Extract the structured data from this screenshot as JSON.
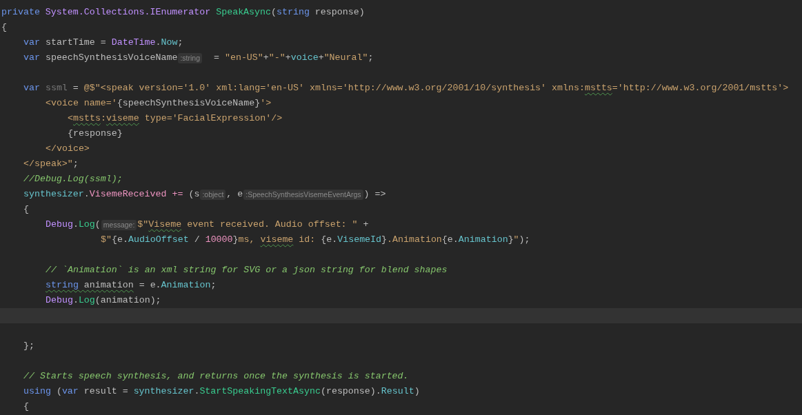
{
  "editor": {
    "lines": [
      {
        "kind": "code",
        "tokens": [
          {
            "kind": "kw",
            "t": "private "
          },
          {
            "kind": "type",
            "t": "System.Collections.IEnumerator "
          },
          {
            "kind": "method",
            "t": "SpeakAsync"
          },
          {
            "kind": "plain",
            "t": "("
          },
          {
            "kind": "kw",
            "t": "string"
          },
          {
            "kind": "plain",
            "t": " response)"
          }
        ]
      },
      {
        "kind": "code",
        "tokens": [
          {
            "kind": "plain",
            "t": "{"
          }
        ],
        "children": [
          {
            "kind": "code",
            "tokens": [
              {
                "kind": "kw",
                "t": "var "
              },
              {
                "kind": "plain",
                "t": "startTime = "
              },
              {
                "kind": "type",
                "t": "DateTime"
              },
              {
                "kind": "plain",
                "t": "."
              },
              {
                "kind": "prop",
                "t": "Now"
              },
              {
                "kind": "plain",
                "t": ";"
              }
            ]
          },
          {
            "kind": "code",
            "tokens": [
              {
                "kind": "kw",
                "t": "var "
              },
              {
                "kind": "plain",
                "t": "speechSynthesisVoiceName"
              },
              {
                "kind": "hint",
                "t": ":string"
              },
              {
                "kind": "plain",
                "t": "  = "
              },
              {
                "kind": "str",
                "t": "\"en-US\""
              },
              {
                "kind": "plain",
                "t": "+"
              },
              {
                "kind": "str",
                "t": "\"-\""
              },
              {
                "kind": "plain",
                "t": "+"
              },
              {
                "kind": "prop",
                "t": "voice"
              },
              {
                "kind": "plain",
                "t": "+"
              },
              {
                "kind": "str",
                "t": "\"Neural\""
              },
              {
                "kind": "plain",
                "t": ";"
              }
            ]
          },
          {
            "kind": "blank"
          },
          {
            "kind": "code",
            "tokens": [
              {
                "kind": "kw",
                "t": "var "
              },
              {
                "kind": "dim",
                "t": "ssml"
              },
              {
                "kind": "plain",
                "t": " = "
              },
              {
                "kind": "str",
                "t": "@$\"<speak version='1.0' xml:lang='en-US' xmlns='http://www.w3.org/2001/10/synthesis' xmlns:"
              },
              {
                "kind": "str",
                "t": "mstts",
                "warn": true
              },
              {
                "kind": "str",
                "t": "='http://www.w3.org/2001/mstts'>"
              }
            ],
            "children": [
              {
                "kind": "code",
                "tokens": [
                  {
                    "kind": "str",
                    "t": "<voice name='"
                  },
                  {
                    "kind": "plain",
                    "t": "{speechSynthesisVoiceName}"
                  },
                  {
                    "kind": "str",
                    "t": "'>"
                  }
                ],
                "children": [
                  {
                    "kind": "code",
                    "tokens": [
                      {
                        "kind": "str",
                        "t": "<"
                      },
                      {
                        "kind": "str",
                        "t": "mstts",
                        "warn": true
                      },
                      {
                        "kind": "str",
                        "t": ":"
                      },
                      {
                        "kind": "str",
                        "t": "viseme",
                        "warn": true
                      },
                      {
                        "kind": "str",
                        "t": " type='FacialExpression'/>"
                      }
                    ]
                  },
                  {
                    "kind": "code",
                    "tokens": [
                      {
                        "kind": "plain",
                        "t": "{response}"
                      }
                    ]
                  }
                ]
              },
              {
                "kind": "code",
                "tokens": [
                  {
                    "kind": "str",
                    "t": "</voice>"
                  }
                ]
              }
            ]
          },
          {
            "kind": "code",
            "tokens": [
              {
                "kind": "str",
                "t": "</speak>\""
              },
              {
                "kind": "plain",
                "t": ";"
              }
            ]
          },
          {
            "kind": "code",
            "tokens": [
              {
                "kind": "comment",
                "t": "//Debug.Log(ssml);"
              }
            ]
          },
          {
            "kind": "code",
            "tokens": [
              {
                "kind": "prop",
                "t": "synthesizer"
              },
              {
                "kind": "plain",
                "t": "."
              },
              {
                "kind": "event",
                "t": "VisemeReceived"
              },
              {
                "kind": "event",
                "t": " += "
              },
              {
                "kind": "plain",
                "t": "("
              },
              {
                "kind": "plain",
                "t": "s"
              },
              {
                "kind": "hint",
                "t": ":object"
              },
              {
                "kind": "plain",
                "t": ", e"
              },
              {
                "kind": "hint",
                "t": ":SpeechSynthesisVisemeEventArgs"
              },
              {
                "kind": "plain",
                "t": ") =>"
              }
            ]
          },
          {
            "kind": "code",
            "tokens": [
              {
                "kind": "plain",
                "t": "{"
              }
            ],
            "children": [
              {
                "kind": "code",
                "tokens": [
                  {
                    "kind": "type",
                    "t": "Debug"
                  },
                  {
                    "kind": "plain",
                    "t": "."
                  },
                  {
                    "kind": "method",
                    "t": "Log"
                  },
                  {
                    "kind": "plain",
                    "t": "("
                  },
                  {
                    "kind": "hint",
                    "t": "message:"
                  },
                  {
                    "kind": "str",
                    "t": "$\""
                  },
                  {
                    "kind": "str",
                    "t": "Viseme",
                    "warn": true
                  },
                  {
                    "kind": "str",
                    "t": " event received. Audio offset: \""
                  },
                  {
                    "kind": "plain",
                    "t": " +"
                  }
                ],
                "children": [
                  {
                    "kind": "continuation",
                    "tokens": [
                      {
                        "kind": "str",
                        "t": "$\""
                      },
                      {
                        "kind": "plain",
                        "t": "{e."
                      },
                      {
                        "kind": "prop",
                        "t": "AudioOffset"
                      },
                      {
                        "kind": "plain",
                        "t": " / "
                      },
                      {
                        "kind": "num",
                        "t": "10000"
                      },
                      {
                        "kind": "plain",
                        "t": "}"
                      },
                      {
                        "kind": "str",
                        "t": "ms, "
                      },
                      {
                        "kind": "str",
                        "t": "viseme",
                        "warn": true
                      },
                      {
                        "kind": "str",
                        "t": " id: "
                      },
                      {
                        "kind": "plain",
                        "t": "{e."
                      },
                      {
                        "kind": "prop",
                        "t": "VisemeId"
                      },
                      {
                        "kind": "plain",
                        "t": "}"
                      },
                      {
                        "kind": "str",
                        "t": ".Animation"
                      },
                      {
                        "kind": "plain",
                        "t": "{e."
                      },
                      {
                        "kind": "prop",
                        "t": "Animation"
                      },
                      {
                        "kind": "plain",
                        "t": "}"
                      },
                      {
                        "kind": "str",
                        "t": "\""
                      },
                      {
                        "kind": "plain",
                        "t": ");"
                      }
                    ]
                  }
                ]
              },
              {
                "kind": "blank"
              },
              {
                "kind": "code",
                "tokens": [
                  {
                    "kind": "comment",
                    "t": "// `Animation` is an xml string for SVG or a json string for blend shapes"
                  }
                ]
              },
              {
                "kind": "code",
                "tokens": [
                  {
                    "kind": "kw",
                    "t": "string ",
                    "warn": true
                  },
                  {
                    "kind": "plain",
                    "t": "animation",
                    "warn": true
                  },
                  {
                    "kind": "plain",
                    "t": " = e."
                  },
                  {
                    "kind": "prop",
                    "t": "Animation"
                  },
                  {
                    "kind": "plain",
                    "t": ";"
                  }
                ]
              },
              {
                "kind": "code",
                "tokens": [
                  {
                    "kind": "type",
                    "t": "Debug"
                  },
                  {
                    "kind": "plain",
                    "t": "."
                  },
                  {
                    "kind": "method",
                    "t": "Log"
                  },
                  {
                    "kind": "plain",
                    "t": "(animation);"
                  }
                ]
              },
              {
                "kind": "blank",
                "current": true
              },
              {
                "kind": "blank"
              }
            ]
          },
          {
            "kind": "code",
            "tokens": [
              {
                "kind": "plain",
                "t": "};"
              }
            ]
          },
          {
            "kind": "blank"
          },
          {
            "kind": "code",
            "tokens": [
              {
                "kind": "comment",
                "t": "// Starts speech synthesis, and returns once the synthesis is started."
              }
            ]
          },
          {
            "kind": "code",
            "tokens": [
              {
                "kind": "kw",
                "t": "using "
              },
              {
                "kind": "plain",
                "t": "("
              },
              {
                "kind": "kw",
                "t": "var "
              },
              {
                "kind": "plain",
                "t": "result = "
              },
              {
                "kind": "prop",
                "t": "synthesizer"
              },
              {
                "kind": "plain",
                "t": "."
              },
              {
                "kind": "method",
                "t": "StartSpeakingTextAsync"
              },
              {
                "kind": "plain",
                "t": "(response)."
              },
              {
                "kind": "prop",
                "t": "Result"
              },
              {
                "kind": "plain",
                "t": ")"
              }
            ]
          },
          {
            "kind": "code",
            "tokens": [
              {
                "kind": "plain",
                "t": "{"
              }
            ]
          }
        ]
      }
    ]
  }
}
